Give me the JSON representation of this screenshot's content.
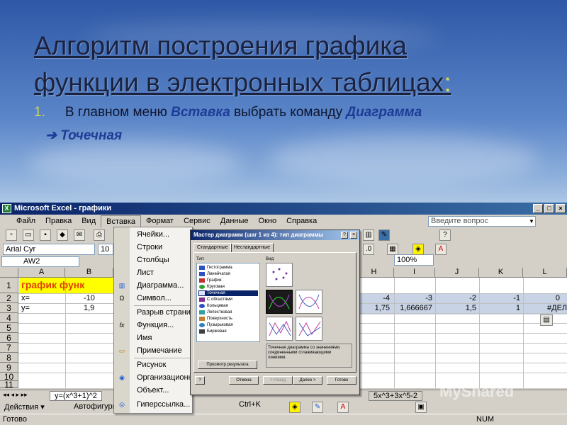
{
  "slide": {
    "title_line1": "Алгоритм построения графика",
    "title_line2": "функции в электронных таблицах",
    "title_colon": ":",
    "step": {
      "number": "1.",
      "text1": "В главном меню ",
      "keyword1": "Вставка",
      "text2": " выбрать команду ",
      "keyword2": "Диаграмма"
    },
    "substep": "➔ Точечная"
  },
  "excel": {
    "window_title": "Microsoft Excel - графики",
    "menu": [
      "Файл",
      "Правка",
      "Вид",
      "Вставка",
      "Формат",
      "Сервис",
      "Данные",
      "Окно",
      "Справка"
    ],
    "help_placeholder": "Введите вопрос",
    "zoom": "100%",
    "font_name": "Arial Cyr",
    "font_size": "10",
    "name_box": "AW2",
    "columns": [
      "A",
      "B",
      "H",
      "I",
      "J",
      "K",
      "L"
    ],
    "rows": [
      "1",
      "2",
      "3",
      "4",
      "5",
      "6",
      "7",
      "8",
      "9",
      "10",
      "11"
    ],
    "cells": {
      "a1": "график функ",
      "a2": "x=",
      "b2": "-10",
      "a3": "y=",
      "b3": "1,9",
      "h2": "-4",
      "i2": "-3",
      "j2": "-2",
      "k2": "-1",
      "l2": "0",
      "h3": "1,75",
      "i3": "1,666667",
      "j3": "1,5",
      "k3": "1",
      "l3": "#ДЕЛ"
    },
    "sheet_tab": "y=(x^3+1)^2",
    "sheet_tab_right": "5x^3+3x^5-2",
    "draw_actions": "Действия ▾",
    "draw_autoshapes": "Автофигуры",
    "status_left": "Готово",
    "status_right": "NUM",
    "insert_menu": {
      "items": [
        "Ячейки...",
        "Строки",
        "Столбцы",
        "Лист",
        "Диаграмма...",
        "Символ...",
        "Разрыв страницы",
        "Функция...",
        "Имя",
        "Примечание",
        "Рисунок",
        "Организационная диаграмма",
        "Объект...",
        "Гиперссылка..."
      ],
      "hyperlink_shortcut": "Ctrl+K"
    },
    "wizard": {
      "title": "Мастер диаграмм (шаг 1 из 4): тип диаграммы",
      "tabs": [
        "Стандартные",
        "Нестандартные"
      ],
      "type_label": "Тип:",
      "view_label": "Вид:",
      "types": [
        "Гистограмма",
        "Линейчатая",
        "График",
        "Круговая",
        "Точечная",
        "С областями",
        "Кольцевая",
        "Лепестковая",
        "Поверхность",
        "Пузырьковая",
        "Биржевая"
      ],
      "selected_type": "Точечная",
      "description": "Точечная диаграмма со значениями, соединенными сглаживающими линиями.",
      "preview_button": "Просмотр результата",
      "buttons": [
        "Отмена",
        "< Назад",
        "Далее >",
        "Готово"
      ]
    }
  },
  "watermark": "MyShared"
}
